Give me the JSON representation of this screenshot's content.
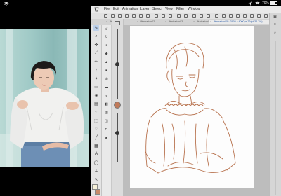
{
  "status": {
    "battery_label": "70%",
    "battery_level": 0.7
  },
  "menu": {
    "items": [
      "File",
      "Edit",
      "Animation",
      "Layer",
      "Select",
      "View",
      "Filter",
      "Window"
    ]
  },
  "tabs": [
    {
      "label": "illustration01",
      "active": false
    },
    {
      "label": "illustration02",
      "active": false
    },
    {
      "label": "illustration03",
      "active": false
    },
    {
      "label": "illustration04",
      "active": false
    },
    {
      "label": "illustration05* (3900 x 4000px 72dpi 34.7%)",
      "active": true
    }
  ],
  "tools": [
    "pen-tool",
    "zoom-tool",
    "move-tool",
    "eyedropper-tool",
    "pencil-tool",
    "brush-tool",
    "airbrush-tool",
    "eraser-tool",
    "fill-tool",
    "gradient-tool",
    "figure-tool",
    "text-tool",
    "select-tool",
    "lasso-tool",
    "operation-tool"
  ],
  "colors": {
    "sketch_stroke": "#b8734f",
    "selected_tool_bg": "#bcd0ea",
    "main_color": "#f5f0d8",
    "sub_color": "#c88a6a"
  }
}
